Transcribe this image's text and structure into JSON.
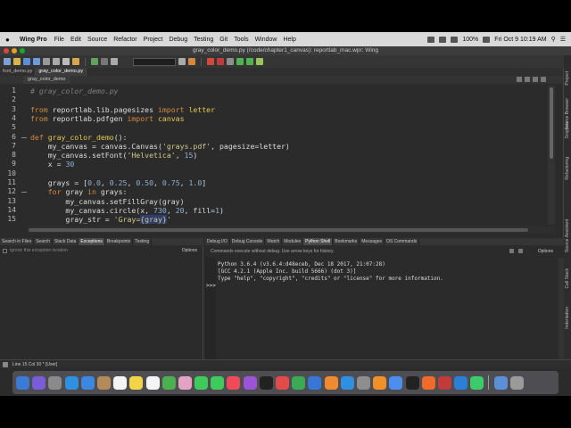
{
  "menubar": {
    "app_name": "Wing Pro",
    "items": [
      "File",
      "Edit",
      "Source",
      "Refactor",
      "Project",
      "Debug",
      "Testing",
      "Git",
      "Tools",
      "Window",
      "Help"
    ],
    "battery": "100%",
    "clock": "Fri Oct 9  10:19 AM"
  },
  "window": {
    "title": "gray_color_demo.py (/code/chapter1_canvas): reportlab_mac.wpr: Wing"
  },
  "file_tabs": [
    {
      "label": "font_demo.py",
      "active": false
    },
    {
      "label": "gray_color_demo.py",
      "active": true
    }
  ],
  "editor": {
    "subtab": "gray_color_demo",
    "lines": [
      {
        "n": "1",
        "html": "<span class=\"cm\"># gray_color_demo.py</span>"
      },
      {
        "n": "2",
        "html": ""
      },
      {
        "n": "3",
        "html": "<span class=\"kw\">from</span> reportlab.lib.pagesizes <span class=\"kw\">import</span> <span class=\"fn\">letter</span>"
      },
      {
        "n": "4",
        "html": "<span class=\"kw\">from</span> reportlab.pdfgen <span class=\"kw\">import</span> <span class=\"fn\">canvas</span>"
      },
      {
        "n": "5",
        "html": ""
      },
      {
        "n": "6",
        "html": "<span class=\"kw\">def</span> <span class=\"fn\">gray_color_demo</span>():"
      },
      {
        "n": "7",
        "html": "    my_canvas = canvas.Canvas(<span class=\"str\">'grays.pdf'</span>, pagesize=letter)"
      },
      {
        "n": "8",
        "html": "    my_canvas.setFont(<span class=\"str\">'Helvetica'</span>, <span class=\"num\">15</span>)"
      },
      {
        "n": "9",
        "html": "    x = <span class=\"num\">30</span>"
      },
      {
        "n": "10",
        "html": ""
      },
      {
        "n": "11",
        "html": "    grays = [<span class=\"num\">0.0</span>, <span class=\"num\">0.25</span>, <span class=\"num\">0.50</span>, <span class=\"num\">0.75</span>, <span class=\"num\">1.0</span>]"
      },
      {
        "n": "12",
        "html": "    <span class=\"kw\">for</span> gray <span class=\"kw\">in</span> grays:"
      },
      {
        "n": "13",
        "html": "        my_canvas.setFillGray(gray)"
      },
      {
        "n": "14",
        "html": "        my_canvas.circle(x, <span class=\"num\">730</span>, <span class=\"num\">20</span>, fill=<span class=\"num\">1</span>)"
      },
      {
        "n": "15",
        "html": "        gray_str = <span class=\"str\">'Gray=<span class=\"hl-blue\">{gray}</span>'</span>"
      }
    ]
  },
  "left_panel": {
    "tabs": [
      "Search in Files",
      "Search",
      "Stack Data",
      "Exceptions",
      "Breakpoints",
      "Testing"
    ],
    "active_tab": "Exceptions",
    "checkbox_label": "Ignore this exception location",
    "options_label": "Options"
  },
  "right_panel": {
    "tabs": [
      "Debug I/O",
      "Debug Console",
      "Watch",
      "Modules",
      "Python Shell",
      "Bookmarks",
      "Messages",
      "OS Commands"
    ],
    "active_tab": "Python Shell",
    "hint": "Commands execute without debug.  Use arrow keys for history.",
    "options_label": "Options",
    "shell_output": "Python 3.6.4 (v3.6.4:d48eceb, Dec 18 2017, 21:07:28)\n[GCC 4.2.1 (Apple Inc. build 5666) (dot 3)]\nType \"help\", \"copyright\", \"credits\" or \"license\" for more information.",
    "prompt": ">>>"
  },
  "right_sidebar": [
    "Refactoring",
    "Snippets",
    "Source Browser",
    "Project",
    "Source Assistant",
    "Call Stack",
    "Indentation"
  ],
  "statusbar": {
    "text": "Line 15 Col 30 * [User]"
  },
  "colors": {
    "editor_bg": "#2b2b2b",
    "keyword": "#d6893e",
    "string": "#d0c98a",
    "number": "#8fb0d6",
    "function": "#e6c84a",
    "comment": "#7f7f7f"
  },
  "dock_icons": [
    "finder-icon",
    "siri-icon",
    "launchpad-icon",
    "safari-icon",
    "mail-icon",
    "contacts-icon",
    "calendar-icon",
    "notes-icon",
    "reminders-icon",
    "maps-icon",
    "photos-icon",
    "messages-icon",
    "facetime-icon",
    "music-icon",
    "podcasts-icon",
    "tv-icon",
    "news-icon",
    "numbers-icon",
    "keynote-icon",
    "pages-icon",
    "app-store-icon",
    "system-preferences-icon",
    "sublime-icon",
    "chrome-icon",
    "terminal-icon",
    "firefox-icon",
    "wing-icon",
    "vscode-icon",
    "pycharm-icon",
    "downloads-icon",
    "trash-icon"
  ]
}
